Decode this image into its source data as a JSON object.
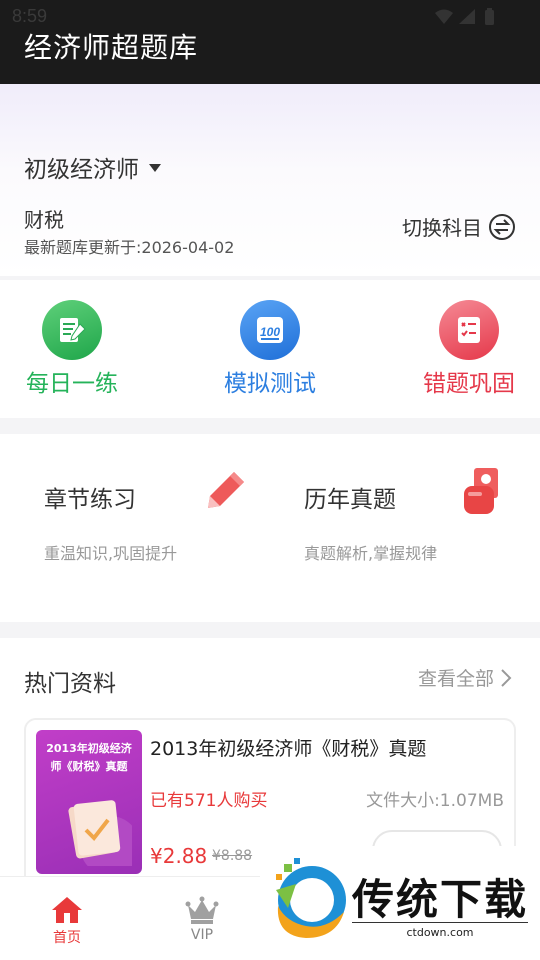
{
  "status": {
    "time": "8:59"
  },
  "header": {
    "title": "经济师超题库"
  },
  "level": {
    "selected": "初级经济师"
  },
  "subject": {
    "name": "财税",
    "update": "最新题库更新于:2026-04-02",
    "switch_label": "切换科目"
  },
  "quick_actions": [
    {
      "label": "每日一练",
      "color": "#25b35a",
      "icon": "notebook-pencil-icon"
    },
    {
      "label": "模拟测试",
      "color": "#2d7fe0",
      "icon": "score-100-icon"
    },
    {
      "label": "错题巩固",
      "color": "#e5384a",
      "icon": "checklist-icon"
    }
  ],
  "practice": [
    {
      "title": "章节练习",
      "subtitle": "重温知识,巩固提升",
      "icon": "pencil-icon"
    },
    {
      "title": "历年真题",
      "subtitle": "真题解析,掌握规律",
      "icon": "scroll-hand-icon"
    }
  ],
  "hot": {
    "title": "热门资料",
    "more": "查看全部",
    "items": [
      {
        "cover_line1": "2013年初级经济",
        "cover_line2": "师《财税》真题",
        "title": "2013年初级经济师《财税》真题",
        "buyers": "已有571人购买",
        "size": "文件大小:1.07MB",
        "price": "¥2.88",
        "old_price": "¥8.88"
      }
    ]
  },
  "nav": {
    "home": "首页",
    "vip": "VIP"
  },
  "watermark": {
    "brand": "传统下载",
    "url": "ctdown.com"
  },
  "colors": {
    "accent_red": "#e8393a",
    "green": "#25b35a",
    "blue": "#2d7fe0",
    "dark_bar": "#1b1b1b"
  }
}
